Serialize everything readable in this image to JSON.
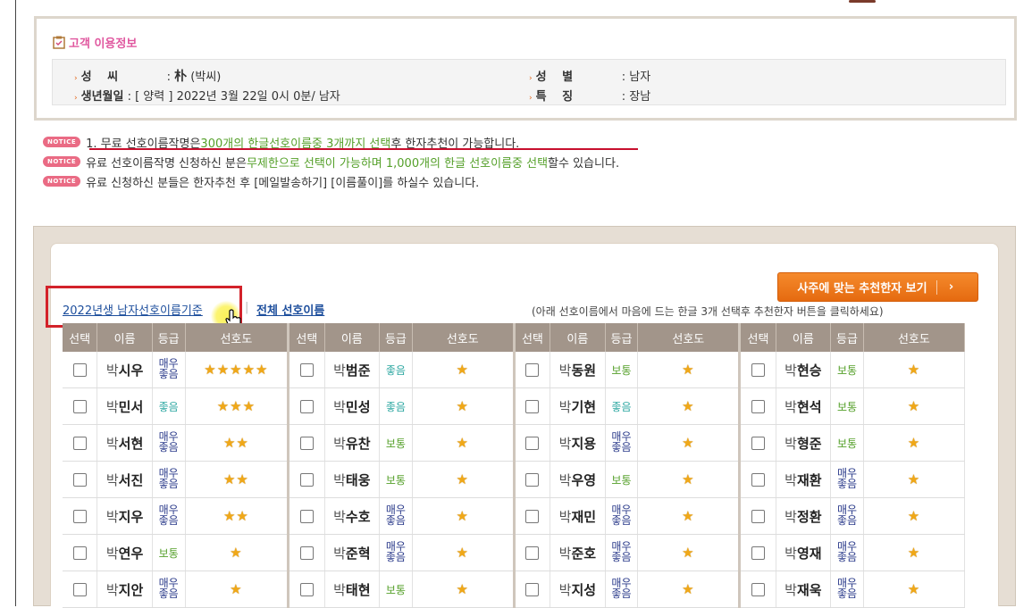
{
  "info": {
    "title": "고객 이용정보",
    "surname_label": "성　 씨",
    "surname_hanja": "朴",
    "surname_value": "(박씨)",
    "birth_label": "생년월일",
    "birth_value": ": [ 양력 ] 2022년 3월 22일 0시 0분/ 남자",
    "gender_label": "성　 별",
    "gender_value": ": 남자",
    "feature_label": "특　 징",
    "feature_value": ": 장남"
  },
  "notices": {
    "badge": "NOTICE",
    "n1_a": "1. 무료 선호이름작명은 ",
    "n1_b": "300개의 한글선호이름중 3개까지 선택",
    "n1_c": "후 한자추천이 가능합니다.",
    "n2_a": "유료 선호이름작명 신청하신 분은",
    "n2_b": "무제한으로 선택이 가능하며 1,000개의 한글 선호이름중 선택",
    "n2_c": "할수 있습니다.",
    "n3": "유료 신청하신 분들은 한자추천 후 [메일발송하기] [이름풀이]를 하실수 있습니다."
  },
  "toolbar": {
    "recommend_button": "사주에 맞는 추천한자 보기",
    "recommend_arrow": "›",
    "tab_2022": "2022년생 남자선호이름기준",
    "tab_sep": "|",
    "tab_all": "전체 선호이름",
    "hint": "(아래 선호이름에서 마음에 드는 한글 3개 선택후 추천한자 버튼을 클릭하세요)"
  },
  "table": {
    "headers": [
      "선택",
      "이름",
      "등급",
      "선호도"
    ],
    "surname": "박",
    "grade_labels": {
      "veryg": "매우좋음",
      "good": "좋음",
      "norm": "보통"
    },
    "rows": [
      [
        {
          "given": "시우",
          "grade": "veryg",
          "stars": 5
        },
        {
          "given": "범준",
          "grade": "good",
          "stars": 1
        },
        {
          "given": "동원",
          "grade": "norm",
          "stars": 1
        },
        {
          "given": "현승",
          "grade": "norm",
          "stars": 1
        }
      ],
      [
        {
          "given": "민서",
          "grade": "good",
          "stars": 3
        },
        {
          "given": "민성",
          "grade": "good",
          "stars": 1
        },
        {
          "given": "기현",
          "grade": "good",
          "stars": 1
        },
        {
          "given": "현석",
          "grade": "norm",
          "stars": 1
        }
      ],
      [
        {
          "given": "서현",
          "grade": "veryg",
          "stars": 2
        },
        {
          "given": "유찬",
          "grade": "norm",
          "stars": 1
        },
        {
          "given": "지용",
          "grade": "veryg",
          "stars": 1
        },
        {
          "given": "형준",
          "grade": "norm",
          "stars": 1
        }
      ],
      [
        {
          "given": "서진",
          "grade": "veryg",
          "stars": 2
        },
        {
          "given": "태웅",
          "grade": "norm",
          "stars": 1
        },
        {
          "given": "우영",
          "grade": "norm",
          "stars": 1
        },
        {
          "given": "재환",
          "grade": "veryg",
          "stars": 1
        }
      ],
      [
        {
          "given": "지우",
          "grade": "veryg",
          "stars": 2
        },
        {
          "given": "수호",
          "grade": "veryg",
          "stars": 1
        },
        {
          "given": "재민",
          "grade": "veryg",
          "stars": 1
        },
        {
          "given": "정환",
          "grade": "veryg",
          "stars": 1
        }
      ],
      [
        {
          "given": "연우",
          "grade": "norm",
          "stars": 1
        },
        {
          "given": "준혁",
          "grade": "veryg",
          "stars": 1
        },
        {
          "given": "준호",
          "grade": "veryg",
          "stars": 1
        },
        {
          "given": "영재",
          "grade": "veryg",
          "stars": 1
        }
      ],
      [
        {
          "given": "지안",
          "grade": "veryg",
          "stars": 1
        },
        {
          "given": "태현",
          "grade": "norm",
          "stars": 1
        },
        {
          "given": "지성",
          "grade": "veryg",
          "stars": 1
        },
        {
          "given": "재욱",
          "grade": "veryg",
          "stars": 1
        }
      ]
    ]
  }
}
